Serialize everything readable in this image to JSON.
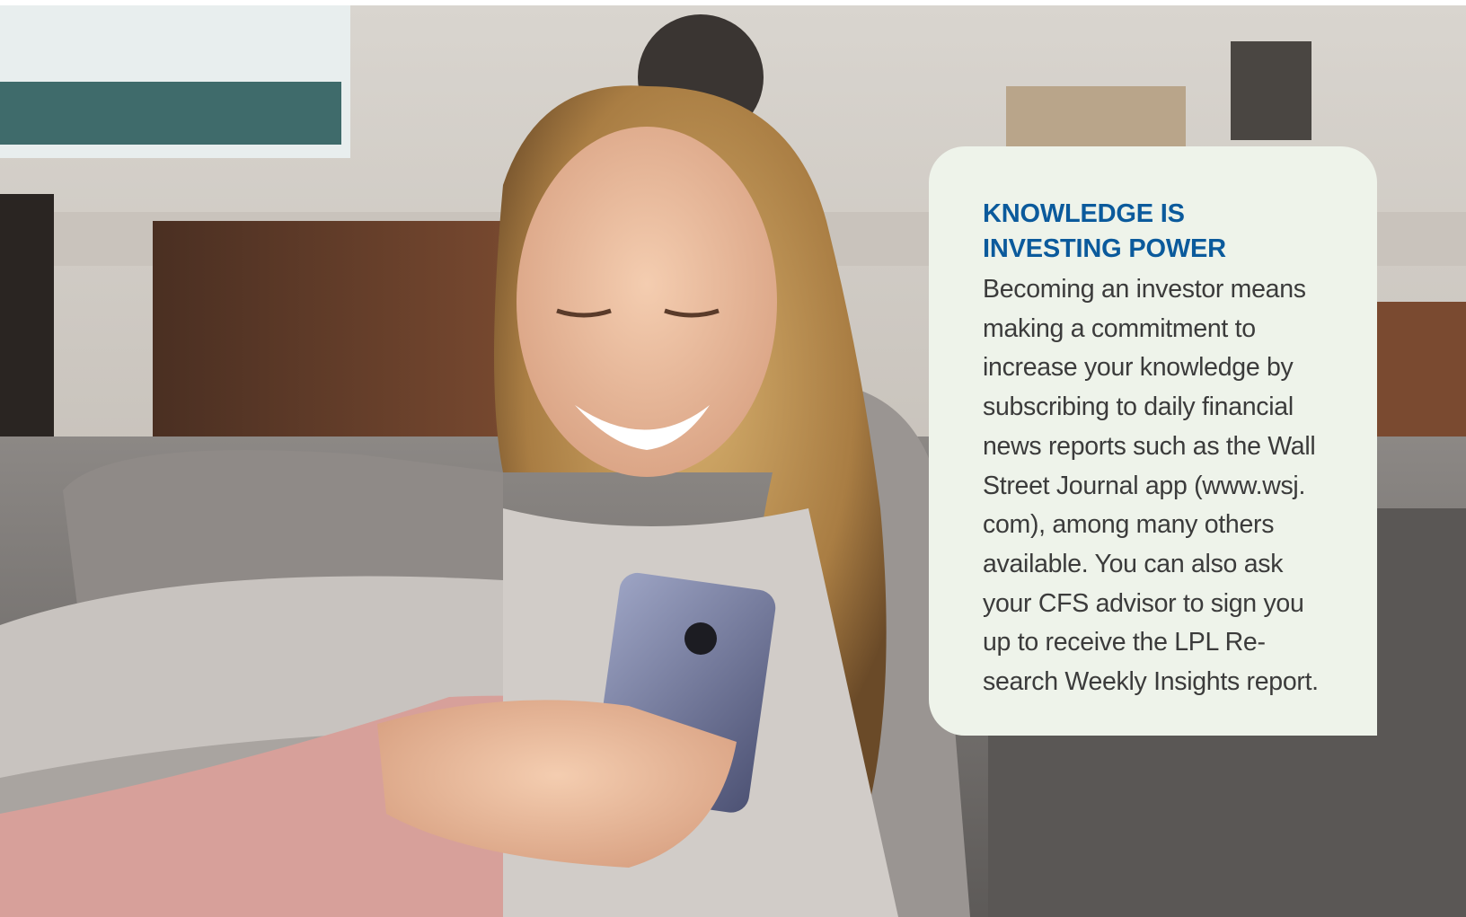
{
  "card": {
    "title_line1": "KNOWLEDGE IS",
    "title_line2": "INVESTING POWER",
    "body": "Becoming an investor means\nmaking a commitment to\nincrease your knowledge by\nsubscribing to daily financial\nnews reports such as the Wall\nStreet Journal app (www.wsj.\ncom), among many others\navailable. You can also ask\nyour CFS advisor to sign you\nup to receive the LPL Re-\nsearch Weekly Insights report."
  },
  "colors": {
    "card_background": "#eef3ea",
    "title": "#0b5a9c",
    "body_text": "#3b3b3b"
  }
}
